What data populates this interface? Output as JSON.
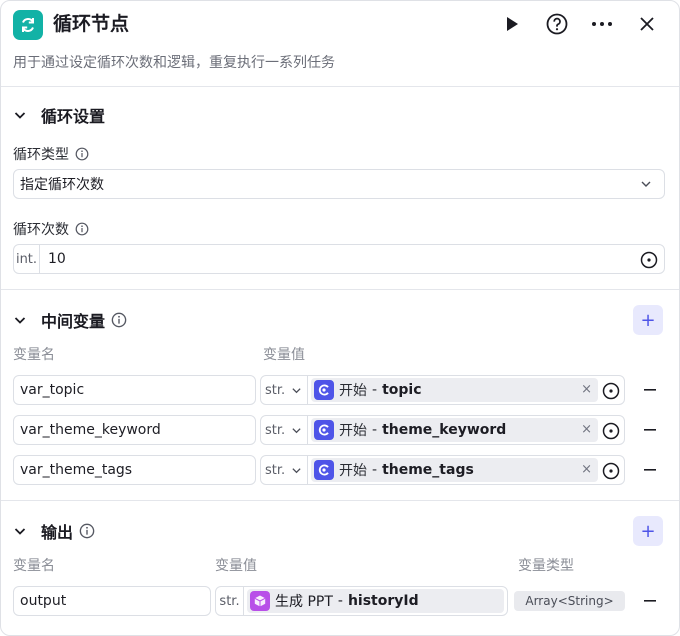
{
  "header": {
    "title": "循环节点",
    "description": "用于通过设定循环次数和逻辑，重复执行一系列任务",
    "icons": [
      "loop-icon",
      "play-icon",
      "help-icon",
      "more-icon",
      "close-icon"
    ]
  },
  "loop_settings": {
    "section_title": "循环设置",
    "loop_type_label": "循环类型",
    "loop_type_value": "指定循环次数",
    "loop_count_label": "循环次数",
    "loop_count_type": "int.",
    "loop_count_value": "10"
  },
  "intermediate_vars": {
    "section_title": "中间变量",
    "col_name": "变量名",
    "col_value": "变量值",
    "add_label": "+",
    "rows": [
      {
        "name": "var_topic",
        "type": "str.",
        "source": "开始",
        "dash": "-",
        "variable": "topic",
        "clear": "×"
      },
      {
        "name": "var_theme_keyword",
        "type": "str.",
        "source": "开始",
        "dash": "-",
        "variable": "theme_keyword",
        "clear": "×"
      },
      {
        "name": "var_theme_tags",
        "type": "str.",
        "source": "开始",
        "dash": "-",
        "variable": "theme_tags",
        "clear": "×"
      }
    ]
  },
  "output": {
    "section_title": "输出",
    "col_name": "变量名",
    "col_value": "变量值",
    "col_type": "变量类型",
    "add_label": "+",
    "rows": [
      {
        "name": "output",
        "type": "str.",
        "source": "生成 PPT",
        "dash": "-",
        "variable": "historyId",
        "var_type": "Array<String>"
      }
    ]
  },
  "colors": {
    "accent": "#4e54e8",
    "node_icon_bg": "#12b2a6",
    "ppt_icon_bg": "#b84fe8"
  }
}
